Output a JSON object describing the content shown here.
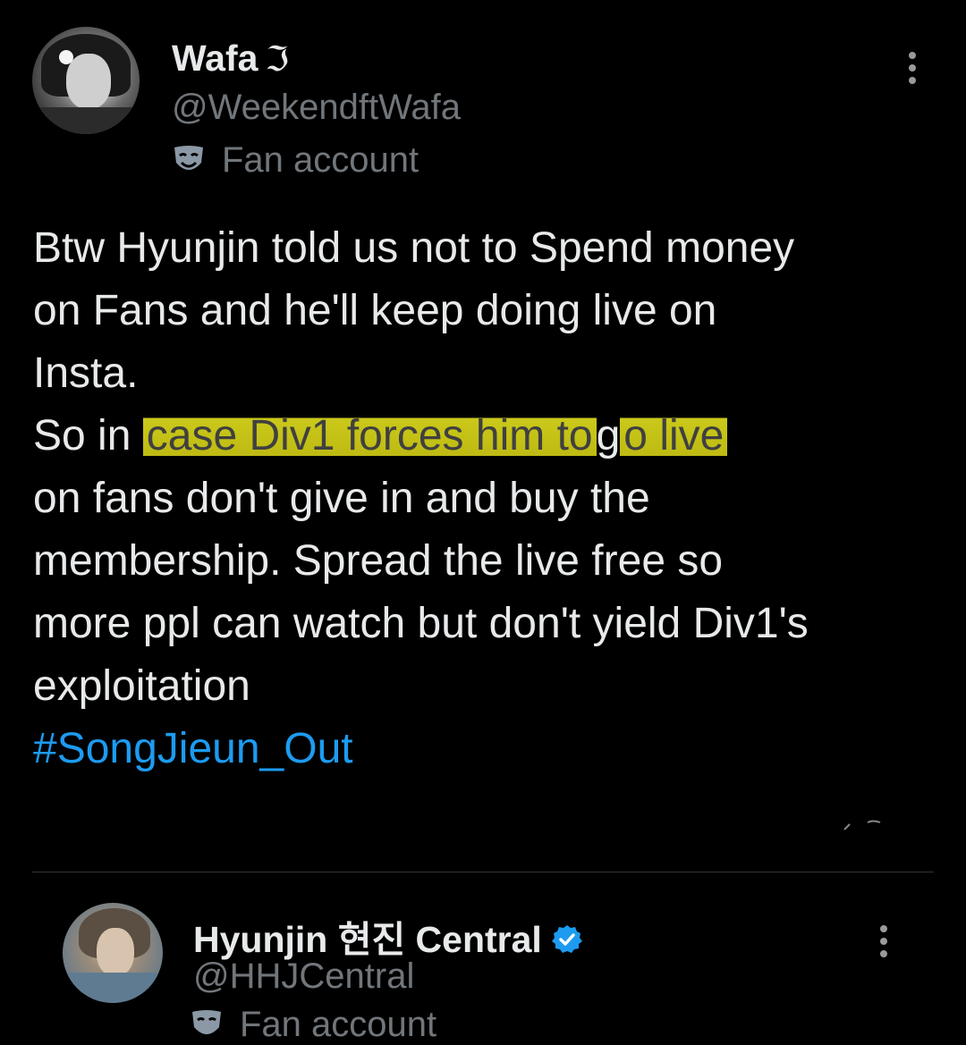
{
  "tweet": {
    "author_name": "Wafa",
    "author_emoji": "ℑ",
    "author_handle": "@WeekendftWafa",
    "account_label": "Fan account",
    "text": {
      "line1": "Btw Hyunjin told us not to Spend money",
      "line2": "on Fans and he'll keep doing live on",
      "line3": "Insta.",
      "line4_prefix": "So in ",
      "line4_highlight_a": "case Div1 forces him to",
      "line4_mid": "g",
      "line4_highlight_b": "o live",
      "line5": "on fans don't give in and buy the",
      "line6": "membership. Spread the live free so",
      "line7": "more ppl can watch but don't yield Div1's",
      "line8": "exploitation",
      "hashtag": "#SongJieun_Out"
    }
  },
  "reply": {
    "author_name": "Hyunjin 현진 Central",
    "author_handle": "@HHJCentral",
    "account_label": "Fan account"
  },
  "colors": {
    "background": "#000000",
    "primary_text": "#e7e9ea",
    "secondary_text": "#71767b",
    "link": "#1d9bf0",
    "highlight": "#d6d41c",
    "verified": "#1d9bf0"
  },
  "icons": {
    "mask": "theater-mask-icon",
    "more": "more-vertical-icon",
    "verified": "verified-badge-icon"
  }
}
